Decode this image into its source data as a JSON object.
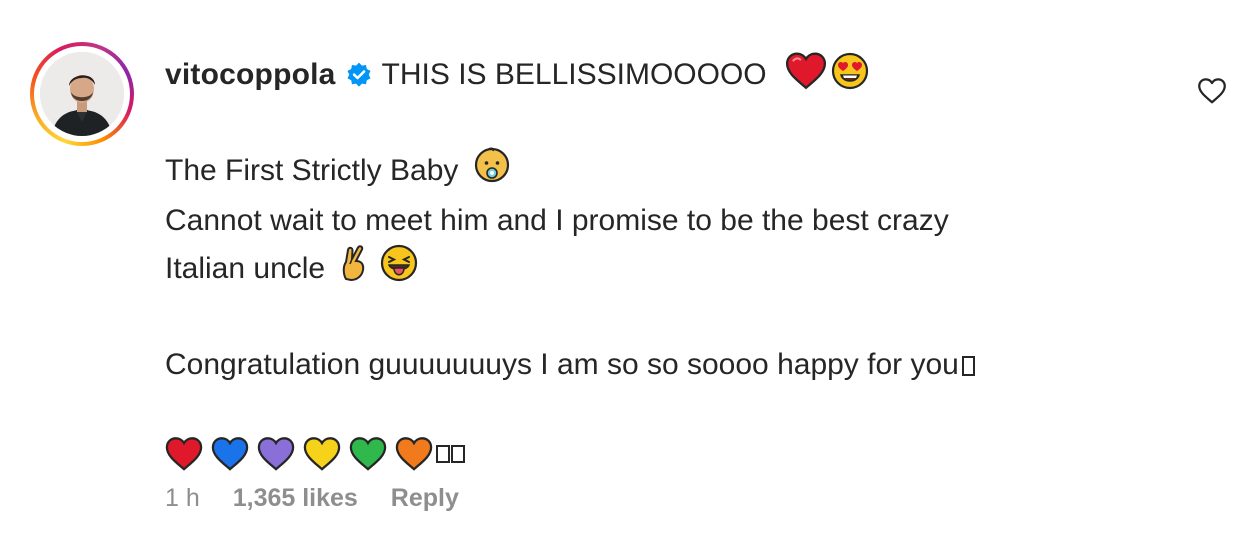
{
  "comment": {
    "username": "vitocoppola",
    "headline": "THIS IS BELLISSIMOOOOO",
    "line1": "The First Strictly Baby",
    "line2": "Cannot wait to meet him and I promise to be the best crazy",
    "line3": "Italian uncle",
    "line4": "Congratulation guuuuuuuys I am so so soooo happy for you",
    "hearts": [
      "#e0182b",
      "#1a73e8",
      "#8a6fd9",
      "#f7d21b",
      "#2fb84c",
      "#f07a1c"
    ]
  },
  "meta": {
    "time": "1 h",
    "likes": "1,365 likes",
    "reply": "Reply"
  },
  "colors": {
    "verified": "#0095f6",
    "secondary_text": "#8e8e8e"
  },
  "icons": [
    "verified-badge-icon",
    "red-heart-emoji",
    "heart-eyes-emoji",
    "baby-emoji",
    "crossed-fingers-emoji",
    "tongue-out-emoji",
    "heart-outline-icon"
  ]
}
